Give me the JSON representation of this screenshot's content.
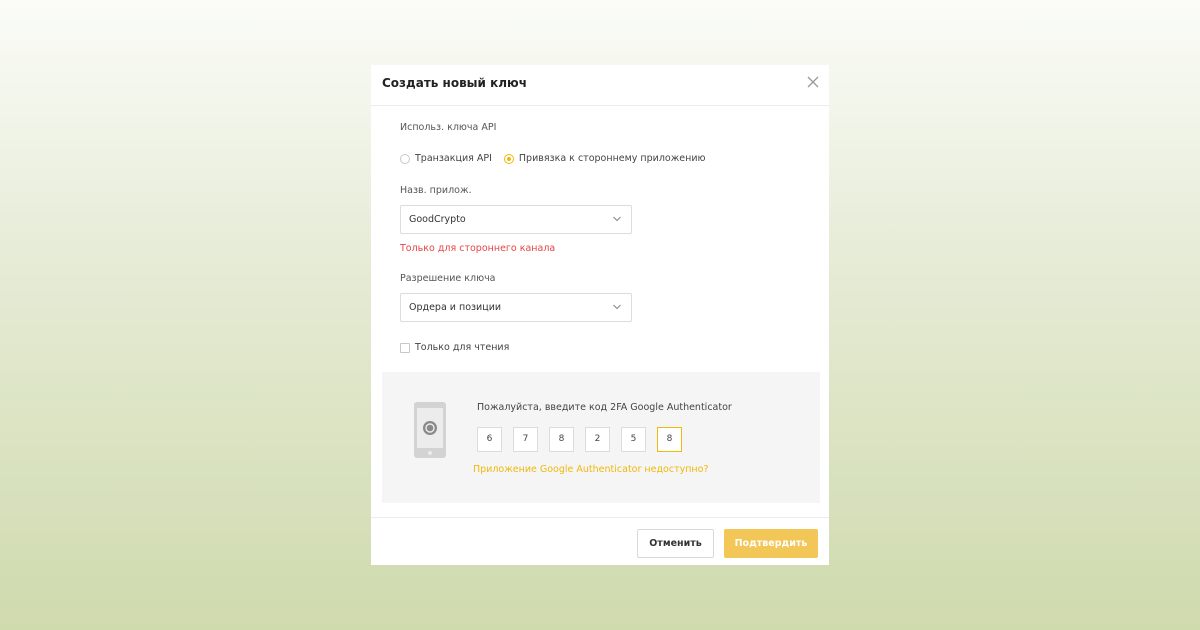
{
  "modal": {
    "title": "Создать новый ключ"
  },
  "form": {
    "api_usage_label": "Использ. ключа API",
    "radio_options": [
      {
        "label": "Транзакция API",
        "checked": false
      },
      {
        "label": "Привязка к стороннему приложению",
        "checked": true
      }
    ],
    "app_name_label": "Назв. прилож.",
    "app_name_value": "GoodCrypto",
    "third_party_notice": "Только для стороннего канала",
    "permission_label": "Разрешение ключа",
    "permission_value": "Ордера и позиции",
    "read_only_label": "Только для чтения",
    "read_only_checked": false
  },
  "twofa": {
    "prompt": "Пожалуйста, введите код 2FA Google Authenticator",
    "digits": [
      "6",
      "7",
      "8",
      "2",
      "5",
      "8"
    ],
    "unavailable_link": "Приложение Google Authenticator недоступно?"
  },
  "footer": {
    "cancel_label": "Отменить",
    "confirm_label": "Подтвердить"
  },
  "colors": {
    "accent": "#f0b90b",
    "error": "#e54545",
    "confirm_button": "#f3c658"
  },
  "icons": {
    "close": "close-icon",
    "chevron": "chevron-down-icon",
    "phone": "phone-authenticator-icon"
  }
}
